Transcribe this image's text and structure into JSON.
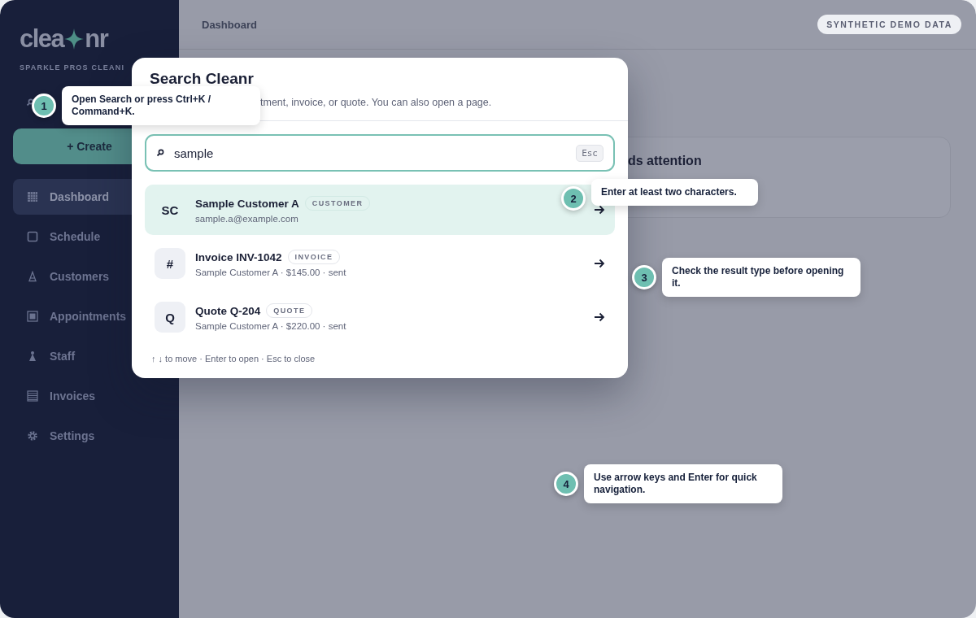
{
  "sidebar": {
    "logo": {
      "left": "clea",
      "right": "nr"
    },
    "org": "SPARKLE PROS CLEANI",
    "create_button": "+ Create",
    "items": [
      {
        "label": "Dashboard",
        "selected": true
      },
      {
        "label": "Schedule",
        "selected": false
      },
      {
        "label": "Customers",
        "selected": false
      },
      {
        "label": "Appointments",
        "selected": false
      },
      {
        "label": "Staff",
        "selected": false
      },
      {
        "label": "Invoices",
        "selected": false
      },
      {
        "label": "Settings",
        "selected": false
      }
    ]
  },
  "header": {
    "breadcrumb": "Dashboard",
    "badge": "SYNTHETIC DEMO DATA"
  },
  "card": {
    "title": "ds attention"
  },
  "search_dialog": {
    "title": "Search Cleanr",
    "subtitle": "tment, invoice, or quote. You can also open a page.",
    "query": "sample",
    "shortcut": "Esc",
    "results": [
      {
        "avatar": "SC",
        "title": "Sample Customer A",
        "type": "CUSTOMER",
        "detail": "sample.a@example.com",
        "selected": true
      },
      {
        "avatar": "#",
        "title": "Invoice INV-1042",
        "type": "INVOICE",
        "detail": "Sample Customer A · $145.00 · sent",
        "selected": false
      },
      {
        "avatar": "Q",
        "title": "Quote Q-204",
        "type": "QUOTE",
        "detail": "Sample Customer A · $220.00 · sent",
        "selected": false
      }
    ],
    "footer": "↑ ↓ to move · Enter to open · Esc to close"
  },
  "tour_steps": [
    {
      "number": "1",
      "text": "Open Search or press Ctrl+K / Command+K."
    },
    {
      "number": "2",
      "text": "Enter at least two characters."
    },
    {
      "number": "3",
      "text": "Check the result type before opening it."
    },
    {
      "number": "4",
      "text": "Use arrow keys and Enter for quick navigation."
    }
  ]
}
